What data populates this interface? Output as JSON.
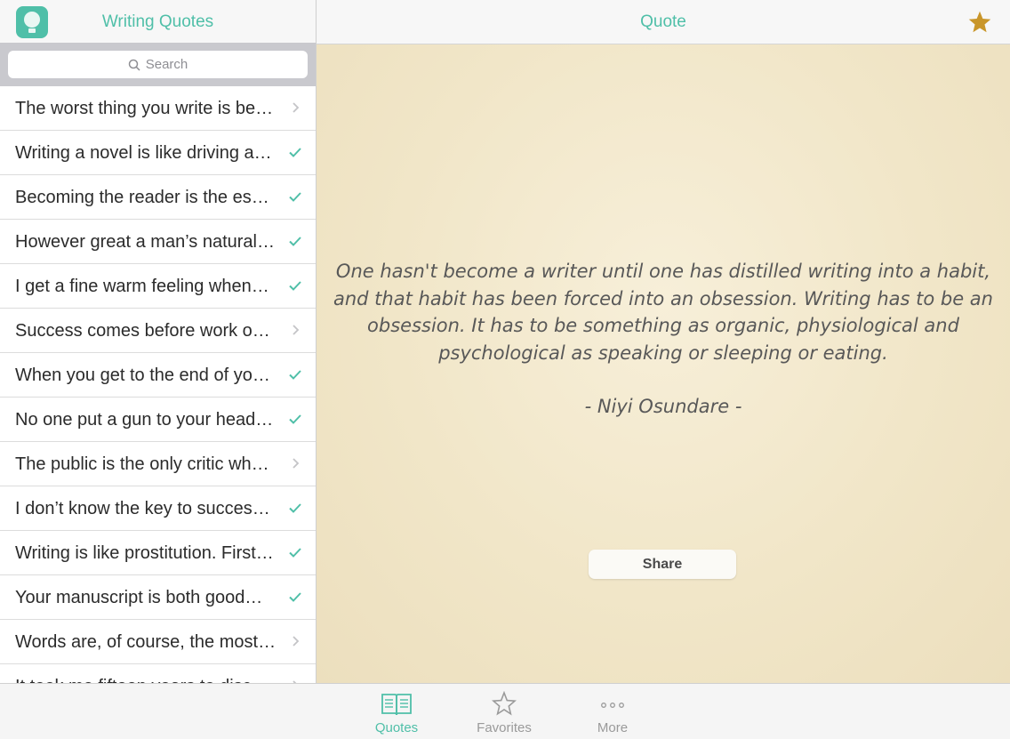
{
  "sidebar": {
    "title": "Writing Quotes",
    "search_placeholder": "Search",
    "items": [
      {
        "text": "The worst thing you write is bet…",
        "state": "chevron"
      },
      {
        "text": "Writing a novel is like driving a…",
        "state": "check"
      },
      {
        "text": "Becoming the reader is the es…",
        "state": "check"
      },
      {
        "text": "However great a man’s natural…",
        "state": "check"
      },
      {
        "text": "I get a fine warm feeling when…",
        "state": "check"
      },
      {
        "text": "Success comes before work o…",
        "state": "chevron"
      },
      {
        "text": "When you get to the end of yo…",
        "state": "check"
      },
      {
        "text": "No one put a gun to your head…",
        "state": "check"
      },
      {
        "text": "The public is the only critic wh…",
        "state": "chevron"
      },
      {
        "text": "I don’t know the key to succes…",
        "state": "check"
      },
      {
        "text": "Writing is like prostitution. First…",
        "state": "check"
      },
      {
        "text": "Your manuscript is both good…",
        "state": "check"
      },
      {
        "text": "Words are, of course, the most…",
        "state": "chevron"
      },
      {
        "text": "It took me fifteen years to discover…",
        "state": "chevron"
      }
    ]
  },
  "detail": {
    "title": "Quote",
    "quote": "One hasn't become a writer until one has distilled writing into a habit, and that habit has been forced into an obsession. Writing has to be an obsession. It has to be something as organic, physiological and psychological as speaking or sleeping or eating.",
    "author": "-  Niyi Osundare  -",
    "share_label": "Share",
    "favorite_icon": "star-filled-icon"
  },
  "tabbar": {
    "tabs": [
      {
        "label": "Quotes",
        "icon": "book-icon",
        "active": true
      },
      {
        "label": "Favorites",
        "icon": "star-icon",
        "active": false
      },
      {
        "label": "More",
        "icon": "more-icon",
        "active": false
      }
    ]
  },
  "colors": {
    "accent": "#4fbfa8",
    "star": "#c9962a",
    "paper": "#f1e6c8"
  }
}
